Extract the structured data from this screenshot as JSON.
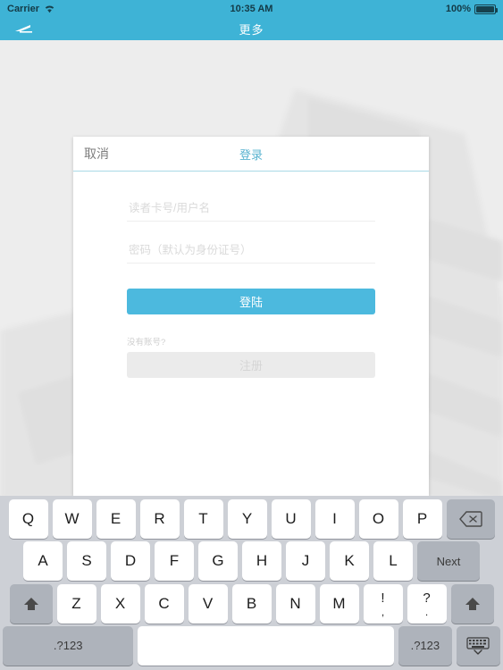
{
  "status_bar": {
    "carrier": "Carrier",
    "wifi_icon": "wifi-icon",
    "time": "10:35 AM",
    "battery_percent": "100%",
    "battery_icon": "battery-full-icon"
  },
  "nav_bar": {
    "back_icon": "back-arrow-icon",
    "title": "更多",
    "bg_color": "#3eb3d6"
  },
  "modal": {
    "cancel_label": "取消",
    "title": "登录",
    "title_color": "#59b3d0",
    "username_field": {
      "value": "",
      "placeholder": "读者卡号/用户名"
    },
    "password_field": {
      "value": "",
      "placeholder": "密码（默认为身份证号）"
    },
    "login_button": {
      "label": "登陆",
      "color": "#4cb9de"
    },
    "no_account_label": "没有账号?",
    "register_button": {
      "label": "注册",
      "color": "#ebebeb",
      "disabled": true
    }
  },
  "keyboard": {
    "row1": [
      "Q",
      "W",
      "E",
      "R",
      "T",
      "Y",
      "U",
      "I",
      "O",
      "P"
    ],
    "delete_icon": "delete-backspace-icon",
    "row2": [
      "A",
      "S",
      "D",
      "F",
      "G",
      "H",
      "J",
      "K",
      "L"
    ],
    "next_label": "Next",
    "shift_icon": "shift-up-arrow-icon",
    "row3": [
      "Z",
      "X",
      "C",
      "V",
      "B",
      "N",
      "M"
    ],
    "punct1": {
      "top": "!",
      "bottom": ","
    },
    "punct2": {
      "top": "?",
      "bottom": "."
    },
    "numeric_left_label": ".?123",
    "space_label": "",
    "numeric_right_label": ".?123",
    "hide_keyboard_icon": "hide-keyboard-icon",
    "bg_color": "#cdd0d6"
  }
}
